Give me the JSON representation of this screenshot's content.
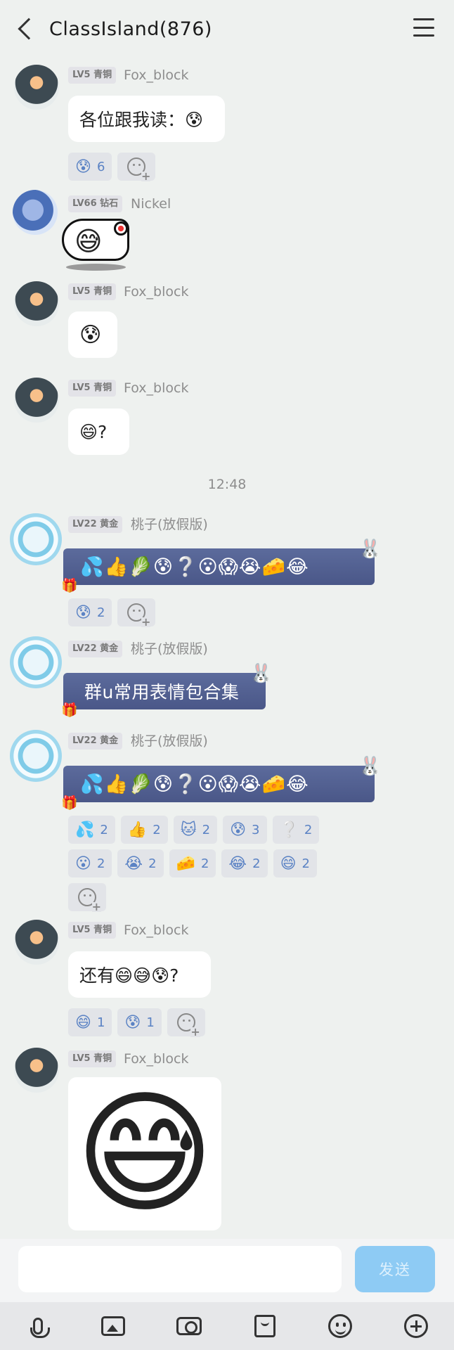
{
  "header": {
    "title": "ClassIsland(876)",
    "back_icon": "chevron-left-icon",
    "menu_icon": "hamburger-menu-icon"
  },
  "messages": [
    {
      "badge": "LV5 青铜",
      "name": "Fox_block",
      "text": "各位跟我读：😰",
      "reactions": [
        {
          "emoji": "😰",
          "count": "6"
        }
      ]
    },
    {
      "badge": "LV66 钻石",
      "name": "Nickel",
      "sticker_face": "😅"
    },
    {
      "badge": "LV5 青铜",
      "name": "Fox_block",
      "text": "😰"
    },
    {
      "badge": "LV5 青铜",
      "name": "Fox_block",
      "text": "😄?"
    },
    {
      "badge": "LV22 黄金",
      "name": "桃子(放假版)",
      "emojis": "💦👍🥬😰❔😮😱😭🧀😂",
      "reactions": [
        {
          "emoji": "😰",
          "count": "2"
        }
      ]
    },
    {
      "badge": "LV22 黄金",
      "name": "桃子(放假版)",
      "text": "群u常用表情包合集"
    },
    {
      "badge": "LV22 黄金",
      "name": "桃子(放假版)",
      "emojis": "💦👍🥬😰❔😮😱😭🧀😂",
      "reactions": [
        {
          "emoji": "💦",
          "count": "2"
        },
        {
          "emoji": "👍",
          "count": "2"
        },
        {
          "emoji": "🐱",
          "count": "2"
        },
        {
          "emoji": "😰",
          "count": "3"
        },
        {
          "emoji": "❔",
          "count": "2"
        },
        {
          "emoji": "😮",
          "count": "2"
        },
        {
          "emoji": "😭",
          "count": "2"
        },
        {
          "emoji": "🧀",
          "count": "2"
        },
        {
          "emoji": "😂",
          "count": "2"
        },
        {
          "emoji": "😄",
          "count": "2"
        }
      ]
    },
    {
      "badge": "LV5 青铜",
      "name": "Fox_block",
      "text": "还有😄😅😰?",
      "reactions": [
        {
          "emoji": "😄",
          "count": "1"
        },
        {
          "emoji": "😰",
          "count": "1"
        }
      ]
    },
    {
      "badge": "LV5 青铜",
      "name": "Fox_block",
      "image_emoji": "😅"
    }
  ],
  "timestamp": "12:48",
  "composer": {
    "send_label": "发送",
    "input_value": ""
  },
  "toolbar": {
    "icons": [
      "microphone-icon",
      "image-icon",
      "camera-icon",
      "red-packet-icon",
      "emoji-icon",
      "plus-icon"
    ]
  },
  "colors": {
    "background": "#eef1ef",
    "send_button": "#8ecbf4",
    "reaction_count": "#5a82c4"
  }
}
